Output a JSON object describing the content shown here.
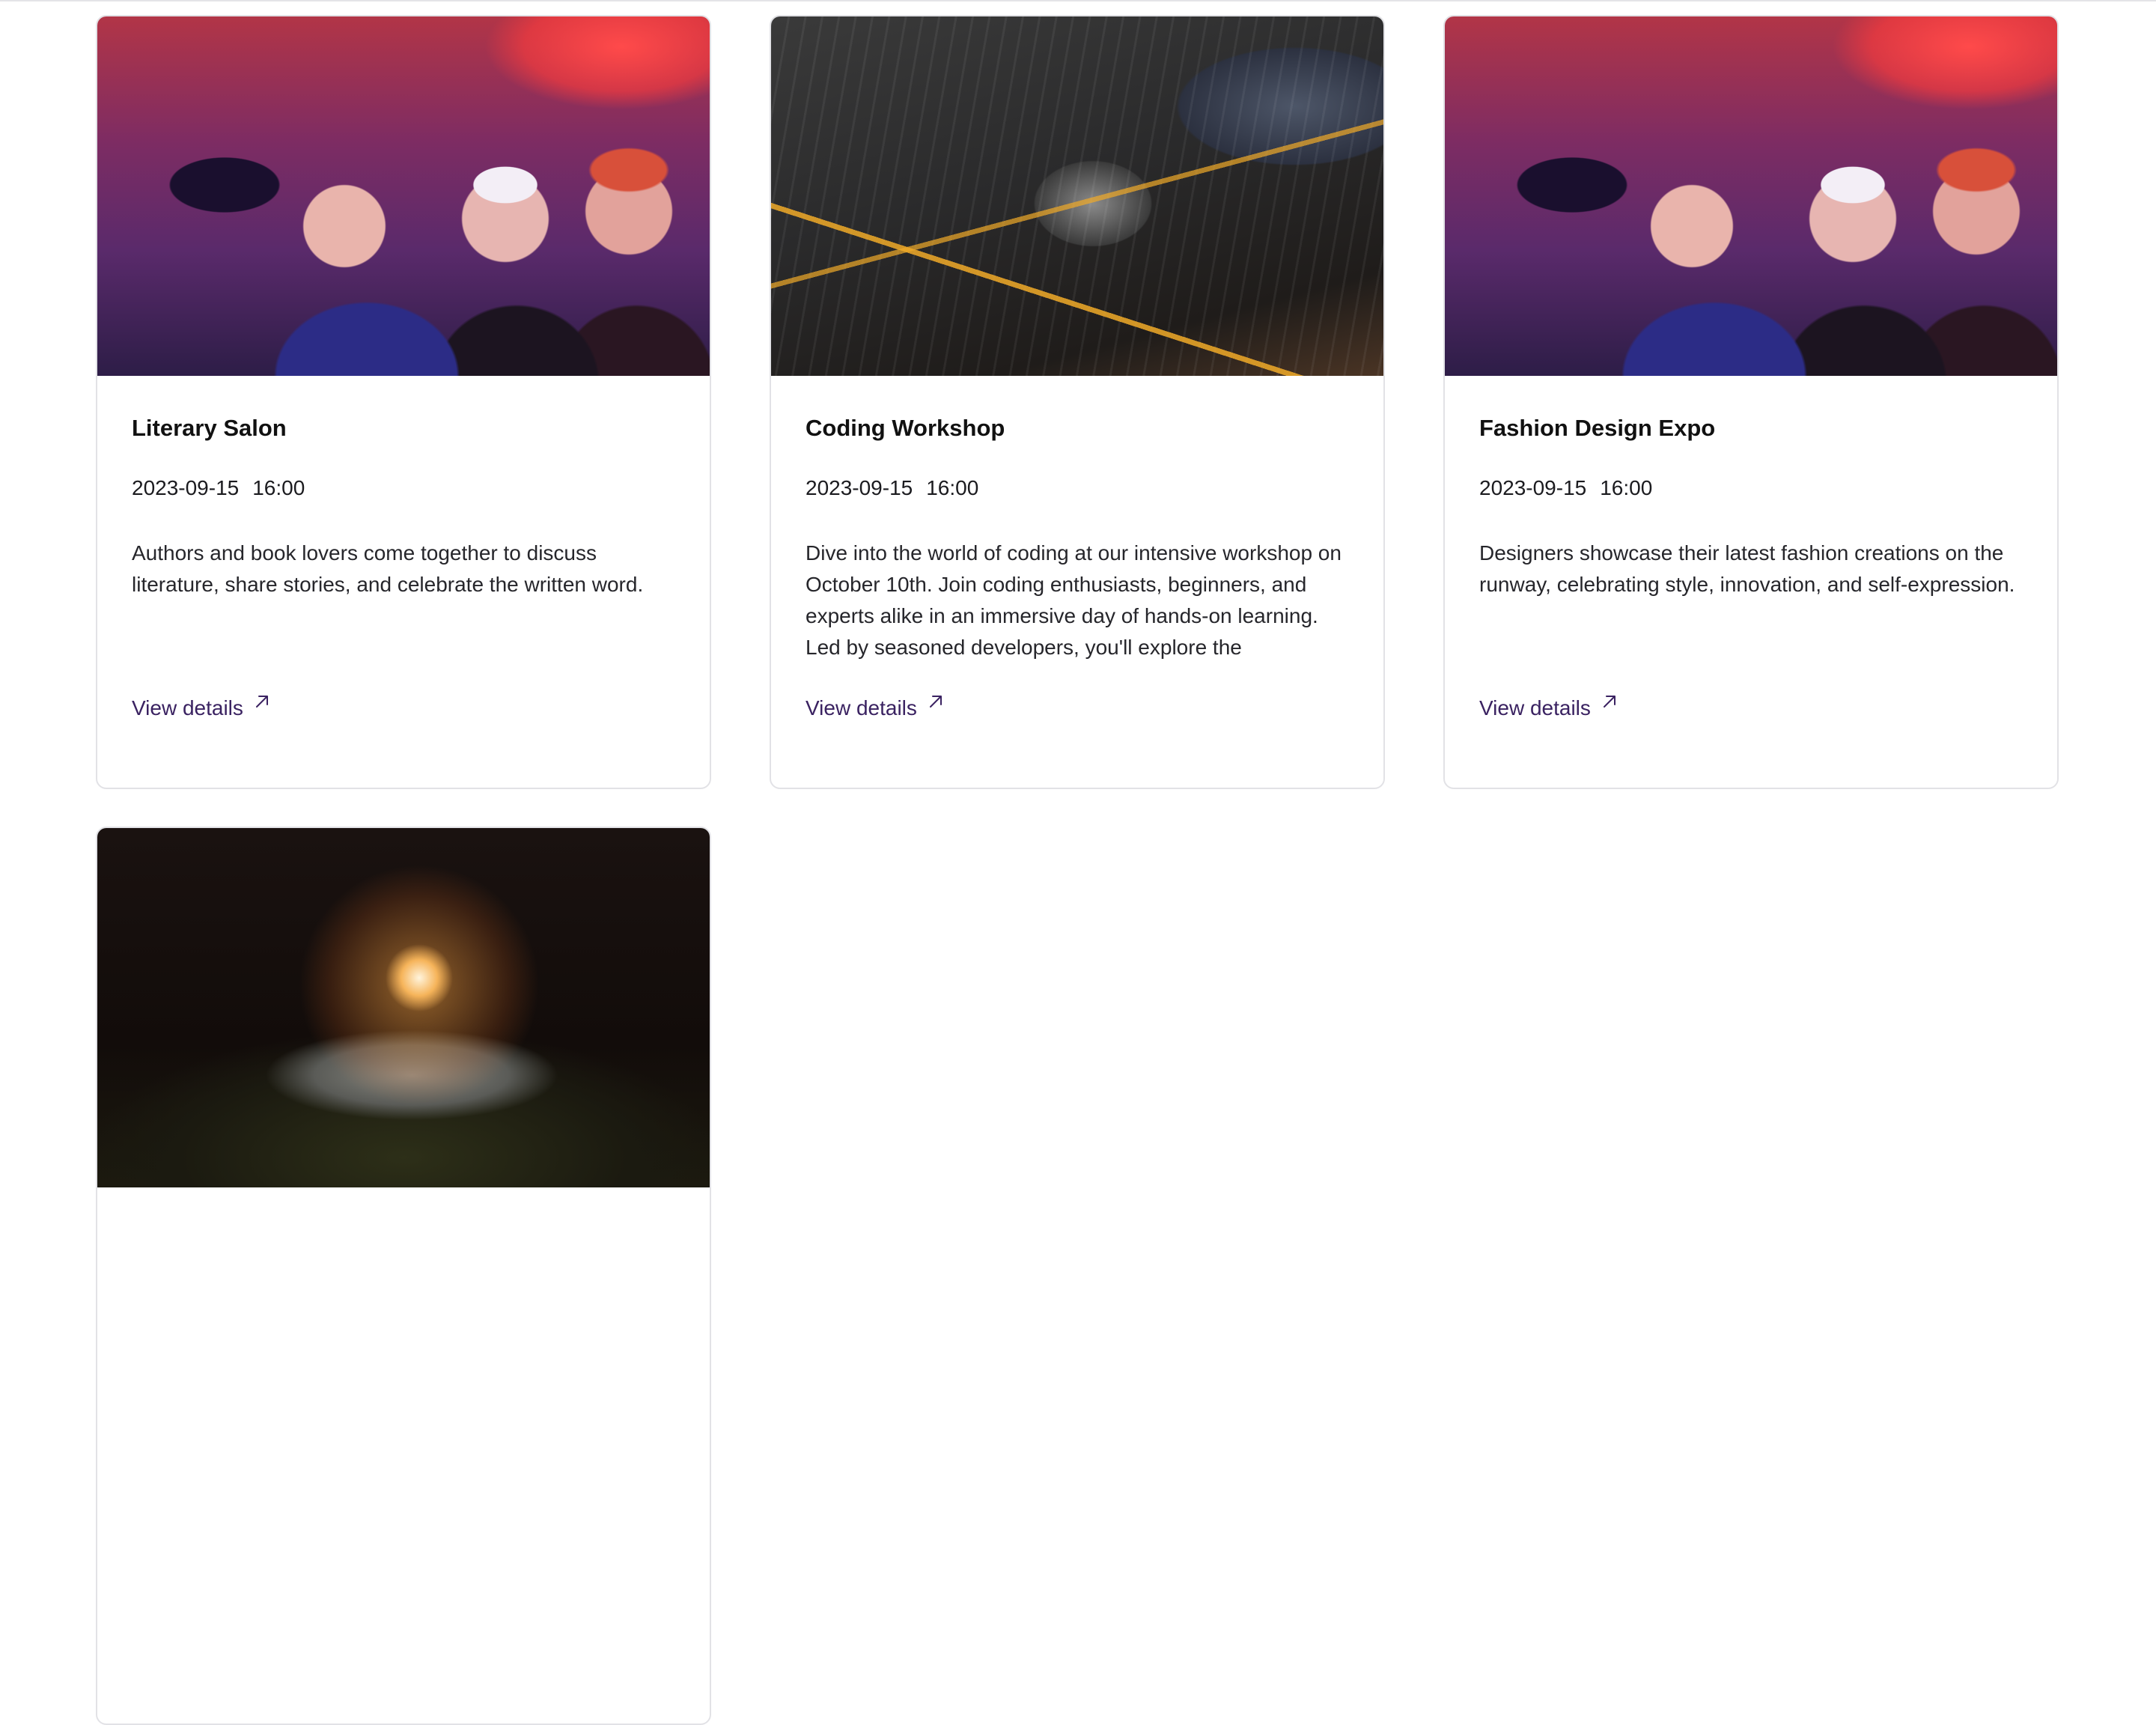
{
  "events": [
    {
      "title": "Literary Salon",
      "date": "2023-09-15",
      "time": "16:00",
      "description": "Authors and book lovers come together to discuss literature, share stories, and celebrate the written word.",
      "link_label": "View details",
      "image": "masquerade-party-photo"
    },
    {
      "title": "Coding Workshop",
      "date": "2023-09-15",
      "time": "16:00",
      "description": "Dive into the world of coding at our intensive workshop on October 10th. Join coding enthusiasts, beginners, and experts alike in an immersive day of hands-on learning. Led by seasoned developers, you'll explore the",
      "link_label": "View details",
      "image": "circuit-board-photo"
    },
    {
      "title": "Fashion Design Expo",
      "date": "2023-09-15",
      "time": "16:00",
      "description": "Designers showcase their latest fashion creations on the runway, celebrating style, innovation, and self-expression.",
      "link_label": "View details",
      "image": "masquerade-party-photo"
    },
    {
      "image": "sparkler-candle-photo"
    }
  ],
  "colors": {
    "link": "#3a2261",
    "card_border": "#e2e2e6",
    "title": "#111111"
  },
  "icons": {
    "details_link": "arrow-up-right-icon"
  }
}
